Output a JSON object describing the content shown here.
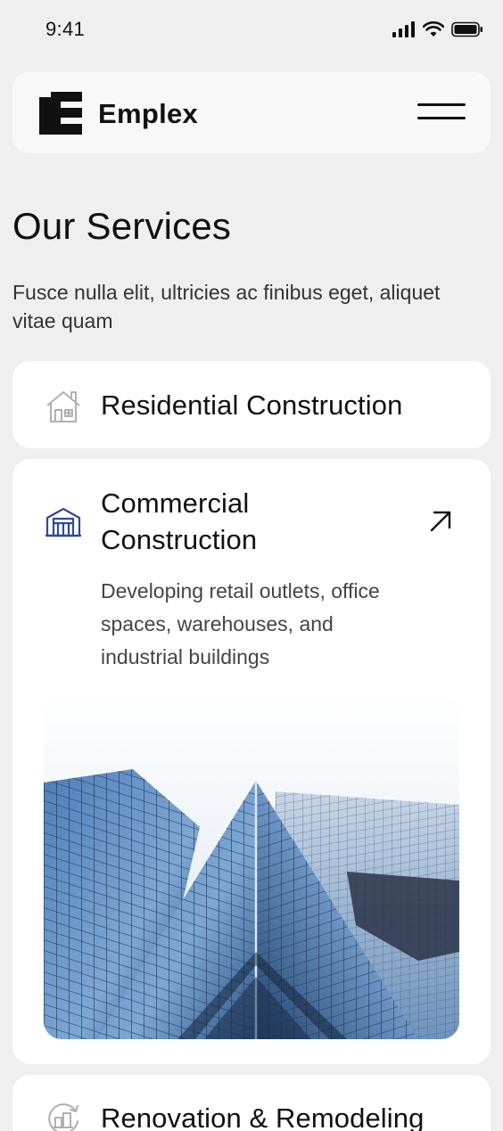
{
  "status_bar": {
    "time": "9:41"
  },
  "header": {
    "brand_name": "Emplex",
    "logo_icon": "stacked-bars-logo",
    "menu_icon": "hamburger-menu-icon"
  },
  "intro": {
    "title": "Our Services",
    "subtitle": "Fusce nulla elit, ultricies ac finibus eget, aliquet vitae quam"
  },
  "services": [
    {
      "title": "Residential Construction",
      "icon": "house-icon",
      "expanded": false
    },
    {
      "title": "Commercial Construction",
      "icon": "warehouse-icon",
      "expanded": true,
      "description": "Developing retail outlets, office spaces, warehouses, and industrial buildings",
      "arrow_icon": "arrow-up-right-icon"
    },
    {
      "title": "Renovation & Remodeling",
      "icon": "renovation-icon",
      "expanded": false
    }
  ],
  "colors": {
    "background": "#efefef",
    "card": "#ffffff",
    "text": "#111111",
    "accent_icon": "#2d4a9a",
    "muted_icon": "#b0b0b0"
  }
}
